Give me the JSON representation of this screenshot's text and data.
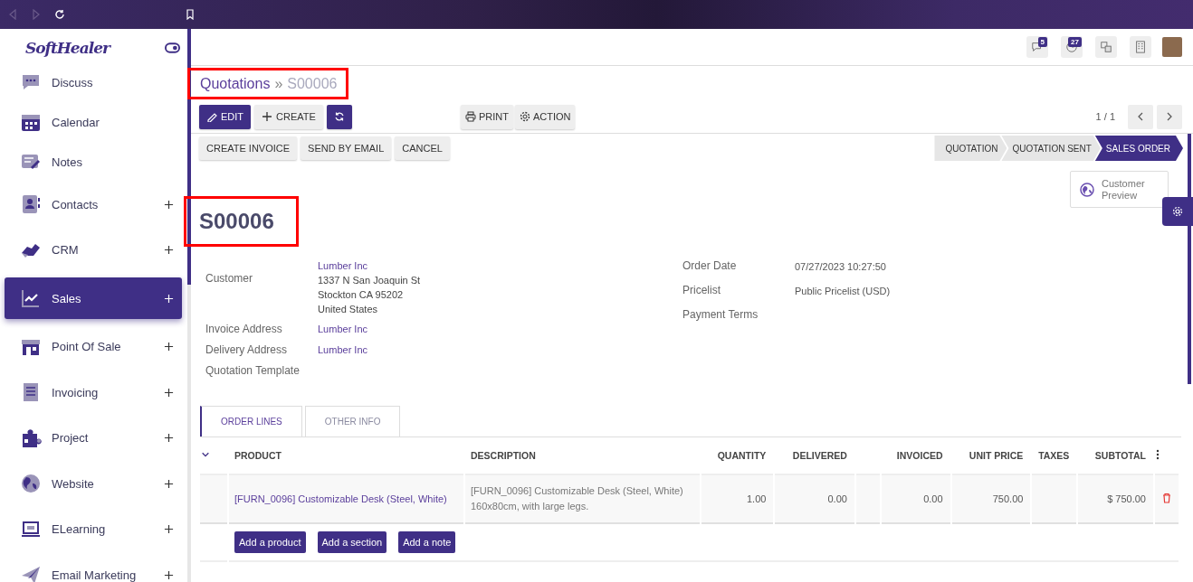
{
  "sidebar": {
    "logo": "SoftHealer",
    "items": [
      {
        "label": "Discuss",
        "expandable": false,
        "selected": false
      },
      {
        "label": "Calendar",
        "expandable": false,
        "selected": false
      },
      {
        "label": "Notes",
        "expandable": false,
        "selected": false
      },
      {
        "label": "Contacts",
        "expandable": true,
        "selected": false
      },
      {
        "label": "CRM",
        "expandable": true,
        "selected": false
      },
      {
        "label": "Sales",
        "expandable": true,
        "selected": true
      },
      {
        "label": "Point Of Sale",
        "expandable": true,
        "selected": false
      },
      {
        "label": "Invoicing",
        "expandable": true,
        "selected": false
      },
      {
        "label": "Project",
        "expandable": true,
        "selected": false
      },
      {
        "label": "Website",
        "expandable": true,
        "selected": false
      },
      {
        "label": "ELearning",
        "expandable": true,
        "selected": false
      },
      {
        "label": "Email Marketing",
        "expandable": true,
        "selected": false
      }
    ]
  },
  "topbar": {
    "messages_badge": "5",
    "activities_badge": "27"
  },
  "breadcrumb": {
    "parent": "Quotations",
    "separator": "»",
    "current": "S00006",
    "highlighted": true
  },
  "toolbar": {
    "buttons": [
      {
        "label": "EDIT",
        "kind": "primary"
      },
      {
        "label": "CREATE",
        "kind": "secondary"
      },
      {
        "kind": "primary"
      }
    ],
    "print": "PRINT",
    "action": "ACTION",
    "pager": "1 / 1"
  },
  "actions": [
    "CREATE INVOICE",
    "SEND BY EMAIL",
    "CANCEL"
  ],
  "status_steps": [
    {
      "label": "QUOTATION",
      "selected": false
    },
    {
      "label": "QUOTATION SENT",
      "selected": false
    },
    {
      "label": "SALES ORDER",
      "selected": true
    }
  ],
  "customer_preview": "Customer Preview",
  "record": {
    "title": "S00006",
    "highlighted": true
  },
  "left_fields": [
    {
      "label": "Customer",
      "link": "Lumber Inc",
      "lines": [
        "1337 N San Joaquin St",
        "Stockton CA 95202",
        "United States"
      ]
    },
    {
      "label": "Invoice Address",
      "link": "Lumber Inc"
    },
    {
      "label": "Delivery Address",
      "link": "Lumber Inc"
    },
    {
      "label": "Quotation Template"
    }
  ],
  "right_fields": [
    {
      "label": "Order Date",
      "value": "07/27/2023 10:27:50"
    },
    {
      "label": "Pricelist",
      "value": "Public Pricelist (USD)"
    },
    {
      "label": "Payment Terms"
    }
  ],
  "tabs": [
    {
      "label": "ORDER LINES",
      "selected": true
    },
    {
      "label": "OTHER INFO",
      "selected": false
    }
  ],
  "table": {
    "columns": [
      "PRODUCT",
      "DESCRIPTION",
      "QUANTITY",
      "DELIVERED",
      null,
      "INVOICED",
      "UNIT PRICE",
      "TAXES",
      "SUBTOTAL"
    ],
    "rows": [
      {
        "cells": [
          "[FURN_0096] Customizable Desk (Steel, White)",
          "[FURN_0096] Customizable Desk (Steel, White)\n160x80cm, with large legs.",
          "1.00",
          "0.00",
          null,
          "0.00",
          "750.00",
          null,
          "$ 750.00"
        ]
      }
    ],
    "add_buttons": [
      "Add a product",
      "Add a section",
      "Add a note"
    ]
  }
}
